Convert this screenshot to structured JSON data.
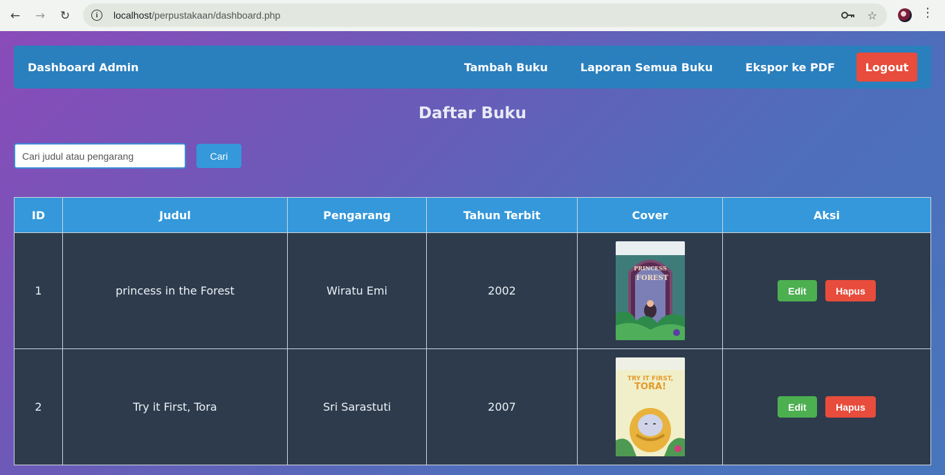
{
  "browser": {
    "url_host": "localhost",
    "url_path": "/perpustakaan/dashboard.php",
    "icons": [
      "back-icon",
      "forward-icon",
      "reload-icon",
      "site-info-icon",
      "password-key-icon",
      "bookmark-star-icon",
      "profile-avatar",
      "menu-dots-icon"
    ]
  },
  "navbar": {
    "brand": "Dashboard Admin",
    "links": [
      "Tambah Buku",
      "Laporan Semua Buku",
      "Ekspor ke PDF"
    ],
    "logout": "Logout"
  },
  "page_title": "Daftar Buku",
  "search": {
    "placeholder": "Cari judul atau pengarang",
    "value": "",
    "button": "Cari"
  },
  "table": {
    "headers": [
      "ID",
      "Judul",
      "Pengarang",
      "Tahun Terbit",
      "Cover",
      "Aksi"
    ],
    "rows": [
      {
        "id": "1",
        "judul": "princess in the Forest",
        "pengarang": "Wiratu Emi",
        "tahun": "2002",
        "edit": "Edit",
        "hapus": "Hapus"
      },
      {
        "id": "2",
        "judul": "Try it First, Tora",
        "pengarang": "Sri Sarastuti",
        "tahun": "2007",
        "edit": "Edit",
        "hapus": "Hapus"
      }
    ]
  },
  "colors": {
    "navbar": "#2a7fbd",
    "header_row": "#3498db",
    "body_row": "#2d3b4d",
    "edit": "#4caf50",
    "danger": "#e74c3c"
  }
}
